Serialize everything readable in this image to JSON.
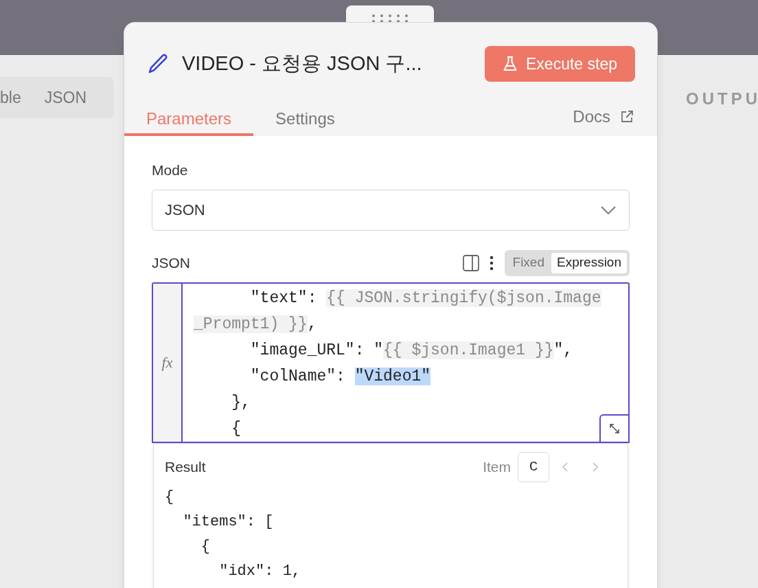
{
  "left_panel": {
    "view_tabs": [
      {
        "label": "ble",
        "selected": false
      },
      {
        "label": "JSON",
        "selected": false
      }
    ]
  },
  "output_panel": {
    "title": "OUTPU"
  },
  "node_panel": {
    "title": "VIDEO - 요청용 JSON 구...",
    "execute_button": "Execute step",
    "tabs": [
      {
        "label": "Parameters",
        "selected": true
      },
      {
        "label": "Settings",
        "selected": false
      }
    ],
    "docs_link": "Docs",
    "mode": {
      "label": "Mode",
      "value": "JSON"
    },
    "json_field": {
      "label": "JSON",
      "mode_toggle": [
        {
          "label": "Fixed",
          "selected": false
        },
        {
          "label": "Expression",
          "selected": true
        }
      ],
      "fx_label": "fx",
      "lines": [
        [
          {
            "text": "      \"text\": ",
            "kind": "plain"
          },
          {
            "text": "{{ JSON.stringify($json.Image",
            "kind": "expression"
          }
        ],
        [
          {
            "text": "_Prompt1) }}",
            "kind": "expression"
          },
          {
            "text": ",",
            "kind": "plain"
          }
        ],
        [
          {
            "text": "      \"image_URL\": \"",
            "kind": "plain"
          },
          {
            "text": "{{ $json.Image1 }}",
            "kind": "expression"
          },
          {
            "text": "\",",
            "kind": "plain"
          }
        ],
        [
          {
            "text": "      \"colName\": ",
            "kind": "plain"
          },
          {
            "text": "\"Video1\"",
            "kind": "selected"
          }
        ],
        [
          {
            "text": "    },",
            "kind": "plain"
          }
        ],
        [
          {
            "text": "    {",
            "kind": "plain"
          }
        ]
      ]
    },
    "result": {
      "title": "Result",
      "item_label": "Item",
      "item_value": "C",
      "lines": [
        "{",
        "  \"items\": [",
        "    {",
        "      \"idx\": 1,"
      ]
    }
  }
}
